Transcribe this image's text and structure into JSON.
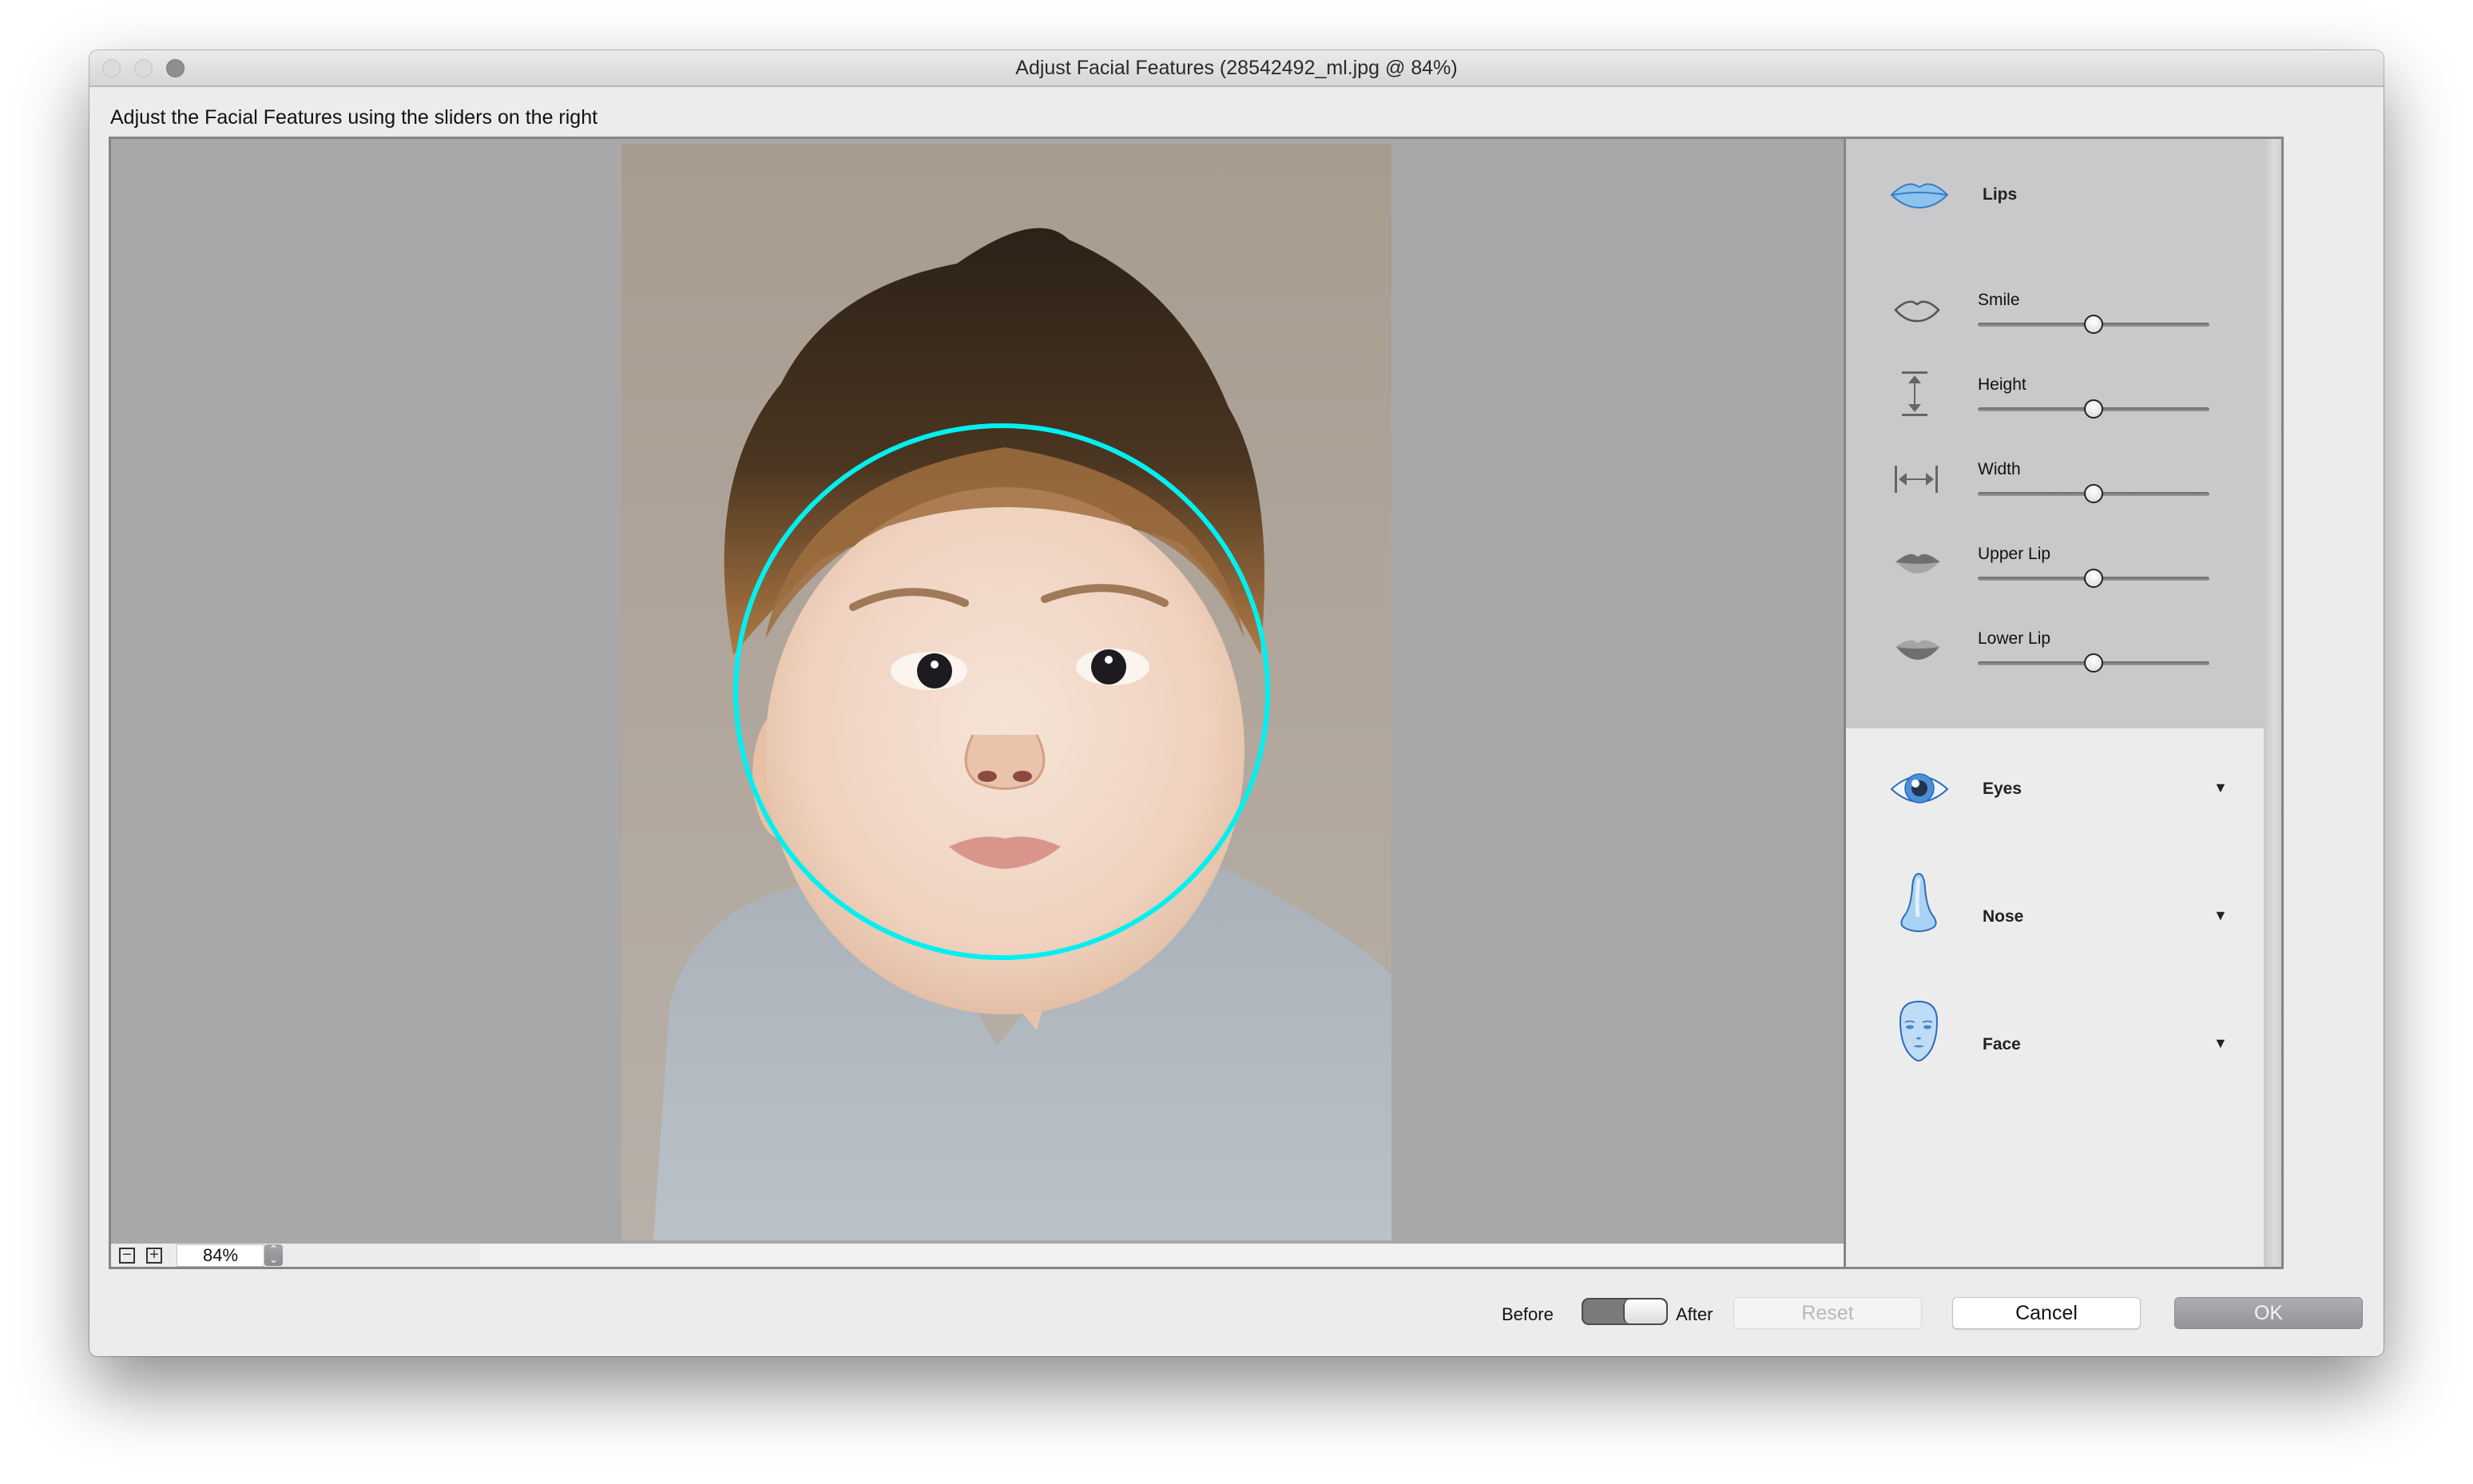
{
  "window": {
    "title": "Adjust Facial Features (28542492_ml.jpg @ 84%)",
    "subtitle": "Adjust the Facial Features using the sliders on the right"
  },
  "canvas": {
    "zoom_value": "84%",
    "zoom_out_symbol": "−",
    "zoom_in_symbol": "+",
    "stepper_up": "⌃",
    "stepper_down": "⌄",
    "overlay_color": "#00f0f0",
    "photo_description": "Portrait photo of a toddler with spiky brown hair wearing a gray hoodie"
  },
  "panel": {
    "lips": {
      "label": "Lips",
      "icon": "lips-icon",
      "sliders": [
        {
          "label": "Smile",
          "icon": "smile-outline-icon",
          "value": 0.5
        },
        {
          "label": "Height",
          "icon": "vertical-resize-icon",
          "value": 0.5
        },
        {
          "label": "Width",
          "icon": "horizontal-resize-icon",
          "value": 0.5
        },
        {
          "label": "Upper Lip",
          "icon": "upper-lip-icon",
          "value": 0.5
        },
        {
          "label": "Lower Lip",
          "icon": "lower-lip-icon",
          "value": 0.5
        }
      ]
    },
    "sections": [
      {
        "label": "Eyes",
        "icon": "eye-icon",
        "arrow": "▼"
      },
      {
        "label": "Nose",
        "icon": "nose-icon",
        "arrow": "▼"
      },
      {
        "label": "Face",
        "icon": "face-icon",
        "arrow": "▼"
      }
    ]
  },
  "footer": {
    "before_label": "Before",
    "after_label": "After",
    "toggle_state": "after",
    "reset_label": "Reset",
    "cancel_label": "Cancel",
    "ok_label": "OK"
  }
}
